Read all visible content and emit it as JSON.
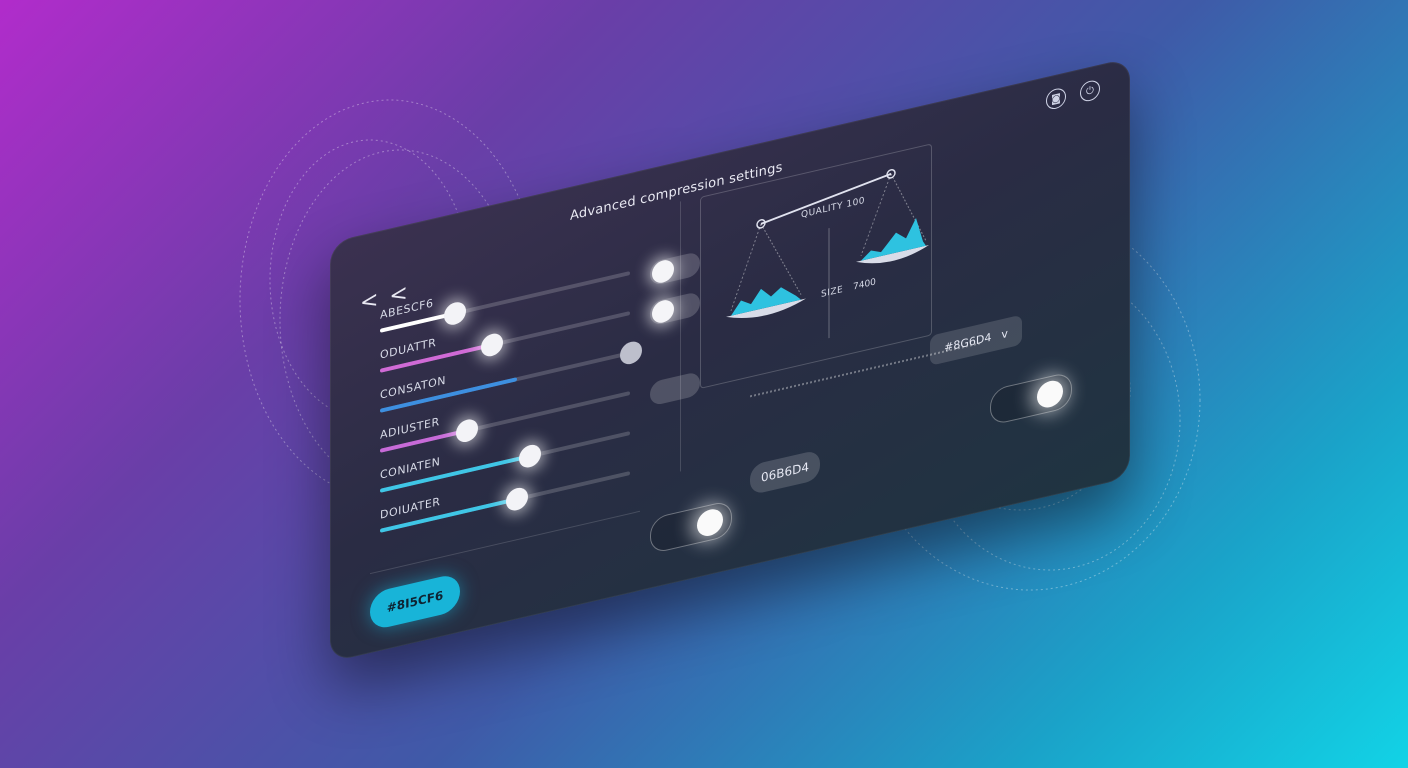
{
  "window": {
    "title": "Advanced compression settings",
    "back_label": "< <"
  },
  "sliders": [
    {
      "label": "ABESCF6",
      "value": 0.3,
      "color": "#ffffff"
    },
    {
      "label": "ODUATTR",
      "value": 0.45,
      "color": "#d06ad6"
    },
    {
      "label": "CONSATON",
      "value": 0.55,
      "color": "#3d8fe0"
    },
    {
      "label": "ADIUSTER",
      "value": 0.35,
      "color": "#c76ad8"
    },
    {
      "label": "CONIATEN",
      "value": 0.6,
      "color": "#3fc6e6"
    },
    {
      "label": "DOIUATER",
      "value": 0.55,
      "color": "#3fc6e6"
    }
  ],
  "scale": {
    "quality_label": "QUALITY 100",
    "size_label": "SIZE",
    "ratio_label": "7400"
  },
  "select": {
    "value": "#8G6D4",
    "chevron": "v"
  },
  "buttons": {
    "primary": "#8I5CF6",
    "hex_pill": "06B6D4"
  },
  "icons": {
    "top_left": "camera-icon",
    "top_right": "power-icon"
  },
  "colors": {
    "accent": "#18b4d8",
    "panel": "#2a2c44"
  }
}
